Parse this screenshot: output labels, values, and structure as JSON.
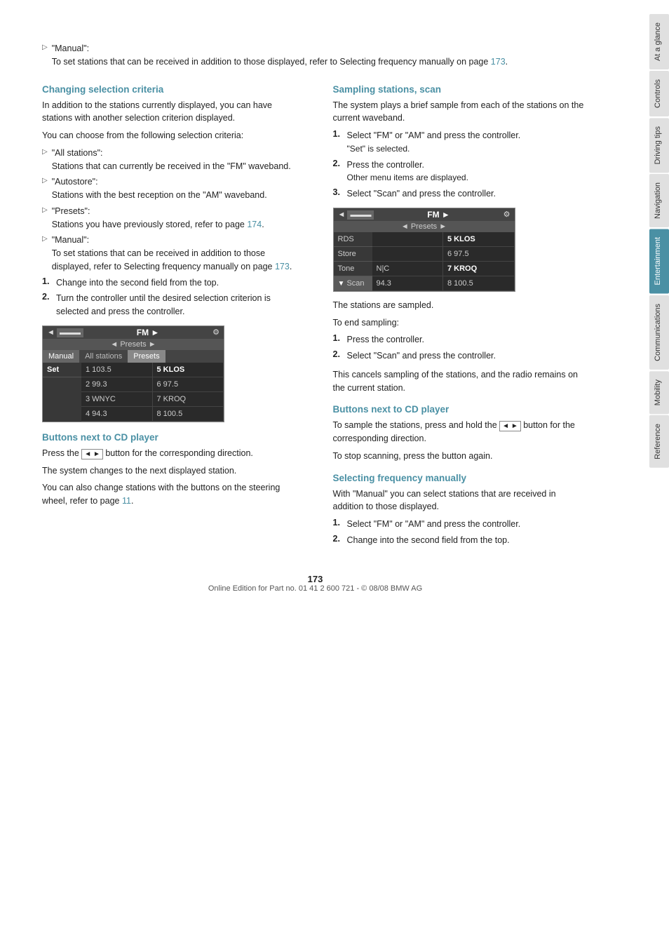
{
  "page": {
    "number": "173",
    "footer": "Online Edition for Part no. 01 41 2 600 721 - © 08/08 BMW AG"
  },
  "sidebar_tabs": [
    {
      "label": "At a glance",
      "active": false
    },
    {
      "label": "Controls",
      "active": false
    },
    {
      "label": "Driving tips",
      "active": false
    },
    {
      "label": "Navigation",
      "active": false
    },
    {
      "label": "Entertainment",
      "active": true
    },
    {
      "label": "Communications",
      "active": false
    },
    {
      "label": "Mobility",
      "active": false
    },
    {
      "label": "Reference",
      "active": false
    }
  ],
  "left_col": {
    "intro_bullet": {
      "label": "\"Manual\":",
      "text": "To set stations that can be received in addition to those displayed, refer to Selecting frequency manually on page 173."
    },
    "changing_criteria": {
      "heading": "Changing selection criteria",
      "para1": "In addition to the stations currently displayed, you can have stations with another selection criterion displayed.",
      "para2": "You can choose from the following selection criteria:",
      "bullets": [
        {
          "label": "\"All stations\":",
          "text": "Stations that can currently be received in the \"FM\" waveband."
        },
        {
          "label": "\"Autostore\":",
          "text": "Stations with the best reception on the \"AM\" waveband."
        },
        {
          "label": "\"Presets\":",
          "text": "Stations you have previously stored, refer to page 174."
        },
        {
          "label": "\"Manual\":",
          "text": "To set stations that can be received in addition to those displayed, refer to Selecting frequency manually on page 173."
        }
      ],
      "steps": [
        "Change into the second field from the top.",
        "Turn the controller until the desired selection criterion is selected and press the controller."
      ]
    },
    "radio_display_1": {
      "top_bar_left": "◄",
      "top_bar_fm": "FM",
      "top_bar_right": "►",
      "top_bar_icon": "⚙",
      "second_bar": "◄ Presets ►",
      "tabs": [
        "Manual",
        "All stations",
        "Presets"
      ],
      "active_tab": "Presets",
      "sidebar_items": [
        "Set"
      ],
      "grid": [
        [
          "1 103.5",
          "5 KLOS"
        ],
        [
          "2 99.3",
          "6 97.5"
        ],
        [
          "3 WNYC",
          "7 KROQ"
        ],
        [
          "4 94.3",
          "8 100.5"
        ]
      ]
    },
    "buttons_cd_left": {
      "heading": "Buttons next to CD player",
      "para1": "Press the ◄ ► button for the corresponding direction.",
      "para2": "The system changes to the next displayed station.",
      "para3": "You can also change stations with the buttons on the steering wheel, refer to page 11."
    }
  },
  "right_col": {
    "sampling": {
      "heading": "Sampling stations, scan",
      "para1": "The system plays a brief sample from each of the stations on the current waveband.",
      "steps": [
        {
          "num": "1.",
          "text": "Select \"FM\" or \"AM\" and press the controller.",
          "note": "\"Set\" is selected."
        },
        {
          "num": "2.",
          "text": "Press the controller.",
          "note": "Other menu items are displayed."
        },
        {
          "num": "3.",
          "text": "Select \"Scan\" and press the controller."
        }
      ],
      "radio_display": {
        "top_bar_left": "◄",
        "top_bar_fm": "FM",
        "top_bar_right": "►",
        "top_bar_icon": "⚙",
        "second_bar": "◄ Presets ►",
        "sidebar_items": [
          "RDS",
          "Store",
          "Tone",
          "Scan"
        ],
        "selected_sidebar": "Scan",
        "grid": [
          [
            "",
            "5 KLOS"
          ],
          [
            "",
            "6 97.5"
          ],
          [
            "N|C",
            "7 KROQ"
          ],
          [
            "94.3",
            "8 100.5"
          ]
        ]
      },
      "after_display": "The stations are sampled.",
      "to_end": "To end sampling:",
      "end_steps": [
        {
          "num": "1.",
          "text": "Press the controller."
        },
        {
          "num": "2.",
          "text": "Select \"Scan\" and press the controller."
        }
      ],
      "end_note": "This cancels sampling of the stations, and the radio remains on the current station."
    },
    "buttons_cd_right": {
      "heading": "Buttons next to CD player",
      "para1": "To sample the stations, press and hold the ◄ ► button for the corresponding direction.",
      "para2": "To stop scanning, press the button again."
    },
    "selecting_freq": {
      "heading": "Selecting frequency manually",
      "para1": "With \"Manual\" you can select stations that are received in addition to those displayed.",
      "steps": [
        {
          "num": "1.",
          "text": "Select \"FM\" or \"AM\" and press the controller."
        },
        {
          "num": "2.",
          "text": "Change into the second field from the top."
        }
      ]
    }
  }
}
